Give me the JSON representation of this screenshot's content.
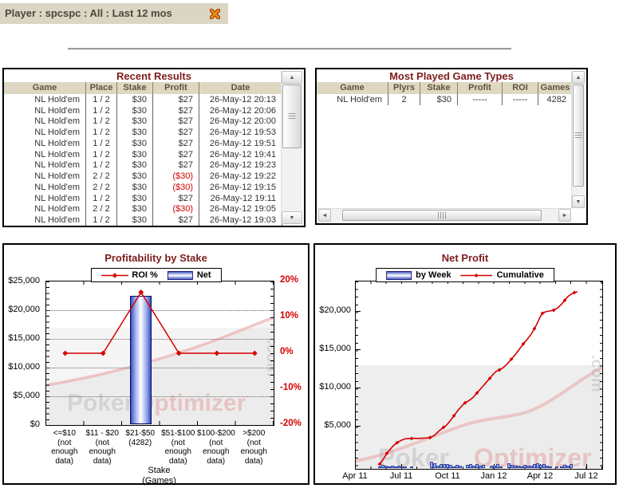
{
  "title_bar": {
    "text": "Player : spcspc : All : Last 12 mos"
  },
  "recent_results": {
    "title": "Recent Results",
    "columns": [
      "Game",
      "Place",
      "Stake",
      "Profit",
      "Date"
    ],
    "rows": [
      [
        "NL Hold'em",
        "1 / 2",
        "$30",
        "$27",
        "26-May-12 20:13"
      ],
      [
        "NL Hold'em",
        "1 / 2",
        "$30",
        "$27",
        "26-May-12 20:06"
      ],
      [
        "NL Hold'em",
        "1 / 2",
        "$30",
        "$27",
        "26-May-12 20:00"
      ],
      [
        "NL Hold'em",
        "1 / 2",
        "$30",
        "$27",
        "26-May-12 19:53"
      ],
      [
        "NL Hold'em",
        "1 / 2",
        "$30",
        "$27",
        "26-May-12 19:51"
      ],
      [
        "NL Hold'em",
        "1 / 2",
        "$30",
        "$27",
        "26-May-12 19:41"
      ],
      [
        "NL Hold'em",
        "1 / 2",
        "$30",
        "$27",
        "26-May-12 19:23"
      ],
      [
        "NL Hold'em",
        "2 / 2",
        "$30",
        "($30)",
        "26-May-12 19:22"
      ],
      [
        "NL Hold'em",
        "2 / 2",
        "$30",
        "($30)",
        "26-May-12 19:15"
      ],
      [
        "NL Hold'em",
        "1 / 2",
        "$30",
        "$27",
        "26-May-12 19:11"
      ],
      [
        "NL Hold'em",
        "2 / 2",
        "$30",
        "($30)",
        "26-May-12 19:05"
      ],
      [
        "NL Hold'em",
        "1 / 2",
        "$30",
        "$27",
        "26-May-12 19:03"
      ]
    ]
  },
  "most_played": {
    "title": "Most Played Game Types",
    "columns": [
      "Game",
      "Plyrs",
      "Stake",
      "Profit",
      "ROI",
      "Games"
    ],
    "rows": [
      [
        "NL Hold'em",
        "2",
        "$30",
        "-----",
        "-----",
        "4282"
      ]
    ]
  },
  "watermark": {
    "word1": "Poker",
    "word2": "Optimizer",
    "word3": ".com"
  },
  "colors": {
    "title_maroon": "#7e1d1d",
    "loss_red": "#d40000",
    "line_red": "#d40000",
    "bar_blue": "#3a50bc",
    "header_bg": "#ded8c2",
    "titlebar_bg": "#dbd5c4"
  },
  "chart_data": [
    {
      "type": "bar",
      "title": "Profitability by Stake",
      "legend": [
        {
          "label": "ROI %",
          "marker": "line"
        },
        {
          "label": "Net",
          "marker": "bar"
        }
      ],
      "categories": [
        "<=$10\n(not\nenough\ndata)",
        "$11 - $20\n(not\nenough\ndata)",
        "$21-$50\n(4282)",
        "$51-$100\n(not\nenough\ndata)",
        "$100-$200\n(not\nenough\ndata)",
        ">$200\n(not\nenough\ndata)"
      ],
      "series": [
        {
          "name": "Net",
          "type": "bar",
          "values": [
            null,
            null,
            22500,
            null,
            null,
            null
          ]
        },
        {
          "name": "ROI %",
          "type": "line",
          "values": [
            0,
            0,
            17,
            0,
            0,
            0
          ]
        }
      ],
      "left_axis": {
        "labels": [
          "$25,000",
          "$20,000",
          "$15,000",
          "$10,000",
          "$5,000",
          "$0"
        ],
        "min": 0,
        "max": 25000
      },
      "right_axis": {
        "labels": [
          "20%",
          "10%",
          "0%",
          "-10%",
          "-20%"
        ],
        "min": -20,
        "max": 20
      },
      "xlabel": "Stake\n(Games)",
      "grid": "dotted-horizontal",
      "legend_position": "top-center"
    },
    {
      "type": "line",
      "title": "Net Profit",
      "legend": [
        {
          "label": "by Week",
          "marker": "bar"
        },
        {
          "label": "Cumulative",
          "marker": "line"
        }
      ],
      "x_ticks": [
        "Apr 11",
        "Jul 11",
        "Oct 11",
        "Jan 12",
        "Apr 12",
        "Jul 12"
      ],
      "y_axis": {
        "ticks": [
          20000,
          15000,
          10000,
          5000
        ],
        "labels": [
          "$20,000",
          "$15,000",
          "$10,000",
          "$5,000"
        ],
        "min": 0
      },
      "grid": "off",
      "legend_position": "top-center",
      "cumulative": [
        [
          30,
          0
        ],
        [
          33,
          400
        ],
        [
          36,
          900
        ],
        [
          39,
          1400
        ],
        [
          43,
          1900
        ],
        [
          47,
          2400
        ],
        [
          52,
          2800
        ],
        [
          57,
          3100
        ],
        [
          62,
          3300
        ],
        [
          70,
          3350
        ],
        [
          78,
          3350
        ],
        [
          86,
          3400
        ],
        [
          93,
          3450
        ],
        [
          98,
          3700
        ],
        [
          104,
          4300
        ],
        [
          110,
          4800
        ],
        [
          113,
          5000
        ],
        [
          118,
          5600
        ],
        [
          123,
          6300
        ],
        [
          128,
          7000
        ],
        [
          133,
          7600
        ],
        [
          137,
          8000
        ],
        [
          142,
          8300
        ],
        [
          147,
          8700
        ],
        [
          152,
          9300
        ],
        [
          158,
          10000
        ],
        [
          163,
          10600
        ],
        [
          168,
          11200
        ],
        [
          172,
          11700
        ],
        [
          176,
          12100
        ],
        [
          180,
          12300
        ],
        [
          185,
          12600
        ],
        [
          190,
          13100
        ],
        [
          195,
          13700
        ],
        [
          200,
          14300
        ],
        [
          205,
          15000
        ],
        [
          210,
          15700
        ],
        [
          215,
          16300
        ],
        [
          220,
          17000
        ],
        [
          224,
          17700
        ],
        [
          228,
          18500
        ],
        [
          231,
          19200
        ],
        [
          234,
          19700
        ],
        [
          238,
          19900
        ],
        [
          243,
          20000
        ],
        [
          248,
          20100
        ],
        [
          253,
          20400
        ],
        [
          258,
          20900
        ],
        [
          262,
          21400
        ],
        [
          266,
          21900
        ],
        [
          270,
          22200
        ],
        [
          274,
          22400
        ],
        [
          278,
          22500
        ]
      ],
      "by_week": [
        [
          30,
          250
        ],
        [
          34,
          450
        ],
        [
          38,
          300
        ],
        [
          42,
          200
        ],
        [
          46,
          350
        ],
        [
          50,
          250
        ],
        [
          54,
          300
        ],
        [
          58,
          200
        ],
        [
          62,
          150
        ],
        [
          70,
          150
        ],
        [
          95,
          800
        ],
        [
          99,
          600
        ],
        [
          103,
          300
        ],
        [
          107,
          500
        ],
        [
          111,
          550
        ],
        [
          115,
          500
        ],
        [
          119,
          450
        ],
        [
          123,
          250
        ],
        [
          127,
          400
        ],
        [
          131,
          350
        ],
        [
          140,
          400
        ],
        [
          144,
          550
        ],
        [
          148,
          350
        ],
        [
          152,
          500
        ],
        [
          156,
          300
        ],
        [
          160,
          450
        ],
        [
          170,
          350
        ],
        [
          174,
          300
        ],
        [
          178,
          500
        ],
        [
          182,
          250
        ],
        [
          192,
          600
        ],
        [
          196,
          450
        ],
        [
          200,
          350
        ],
        [
          204,
          300
        ],
        [
          208,
          250
        ],
        [
          212,
          400
        ],
        [
          216,
          350
        ],
        [
          220,
          300
        ],
        [
          224,
          550
        ],
        [
          228,
          600
        ],
        [
          232,
          450
        ],
        [
          236,
          500
        ],
        [
          240,
          300
        ],
        [
          244,
          200
        ],
        [
          252,
          100
        ],
        [
          258,
          250
        ],
        [
          262,
          400
        ],
        [
          266,
          350
        ],
        [
          270,
          500
        ]
      ]
    }
  ]
}
